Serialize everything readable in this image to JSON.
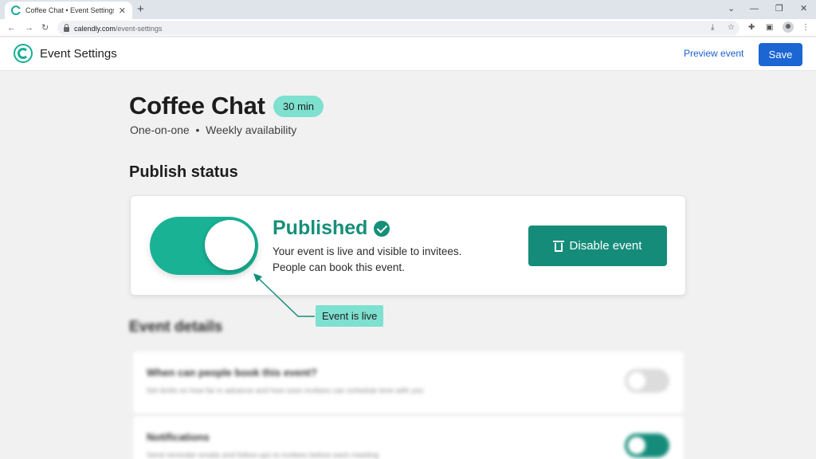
{
  "browser": {
    "tab_title": "Coffee Chat • Event Settings",
    "url_host": "calendly.com",
    "url_path": "/event-settings"
  },
  "app": {
    "title": "Event Settings",
    "preview_label": "Preview event",
    "save_label": "Save"
  },
  "event": {
    "title": "Coffee Chat",
    "duration": "30 min",
    "meta": "One-on-one  •  Weekly availability"
  },
  "publish": {
    "section_title": "Publish status",
    "toggle_on": true,
    "status_title": "Published",
    "line1": "Your event is live and visible to invitees.",
    "line2": "People can book this event.",
    "disable_label": "Disable event",
    "callout": "Event is live"
  },
  "details": {
    "section_title": "Event details",
    "items": [
      {
        "title": "When can people book this event?",
        "desc": "Set limits on how far in advance and how soon invitees can schedule time with you",
        "enabled": false
      },
      {
        "title": "Notifications",
        "desc": "Send reminder emails and follow-ups to invitees before each meeting",
        "enabled": true
      }
    ]
  },
  "colors": {
    "accent": "#19b295",
    "accent_dark": "#158c79",
    "primary_button": "#1b66d2",
    "pill": "#7ee0cf"
  }
}
